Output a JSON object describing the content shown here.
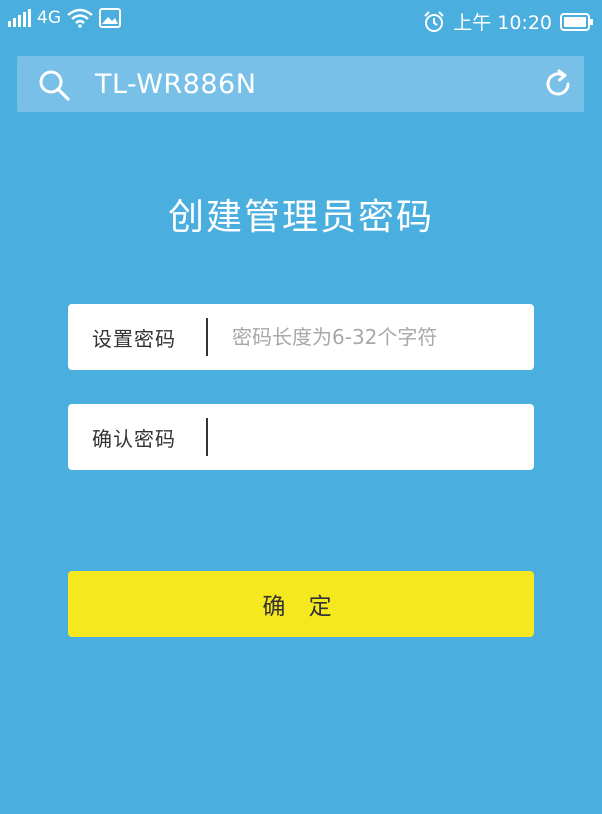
{
  "status_bar": {
    "network": "4G",
    "time": "上午 10:20"
  },
  "search": {
    "value": "TL-WR886N"
  },
  "page": {
    "title": "创建管理员密码"
  },
  "form": {
    "set_password": {
      "label": "设置密码",
      "placeholder": "密码长度为6-32个字符",
      "value": ""
    },
    "confirm_password": {
      "label": "确认密码",
      "placeholder": "",
      "value": ""
    },
    "submit_label": "确 定"
  },
  "colors": {
    "background": "#4aaede",
    "search_bar": "#78c0e8",
    "button": "#f5e81f"
  }
}
